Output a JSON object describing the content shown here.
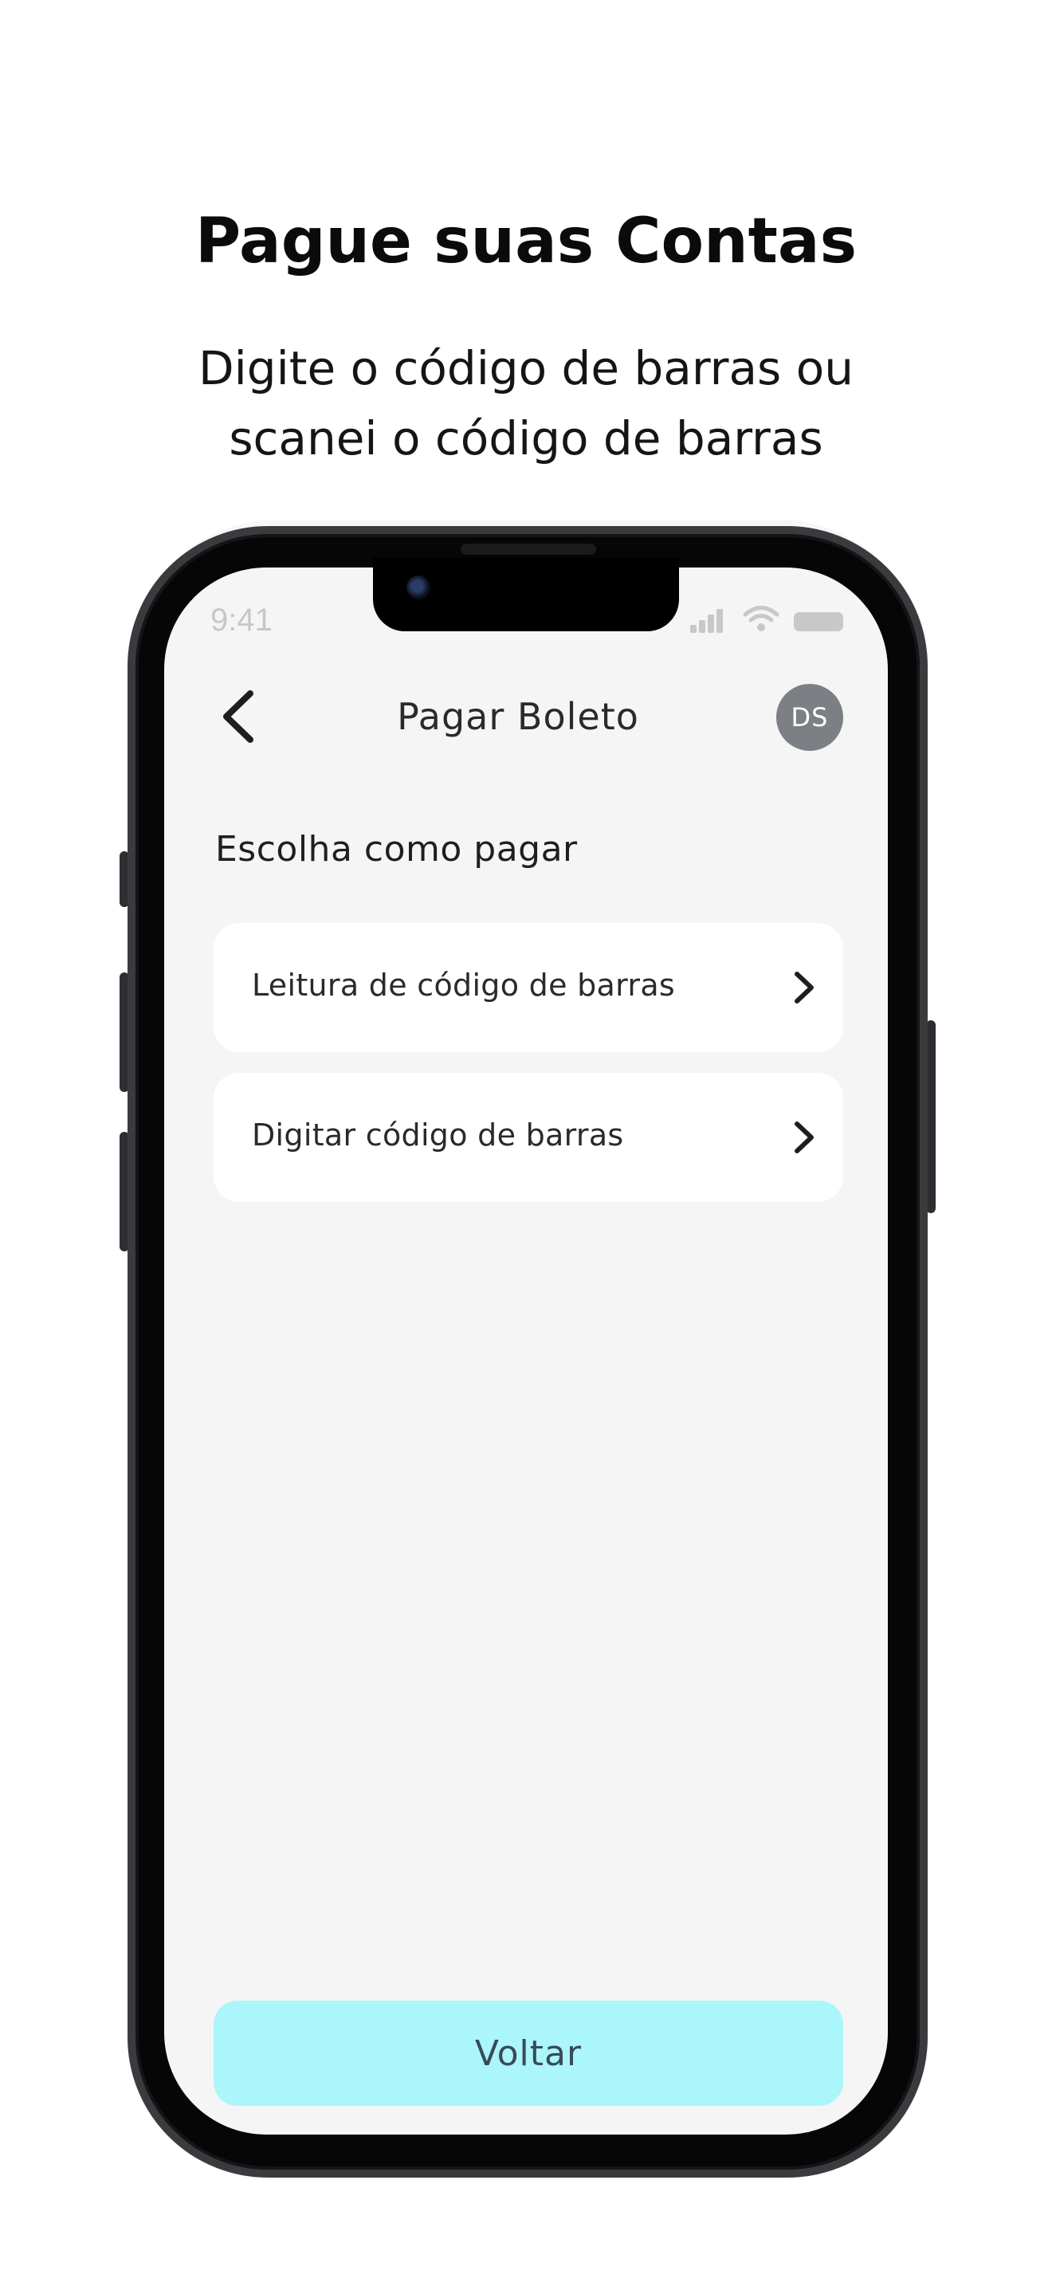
{
  "hero": {
    "title": "Pague suas Contas",
    "subtitle_line1": "Digite o código de barras ou",
    "subtitle_line2": "scanei o código de barras"
  },
  "status_bar": {
    "time": "9:41",
    "icons": [
      "signal-icon",
      "wifi-icon",
      "battery-icon"
    ]
  },
  "header": {
    "back_icon": "chevron-left-icon",
    "title": "Pagar Boleto",
    "avatar_initials": "DS"
  },
  "section": {
    "heading": "Escolha como pagar"
  },
  "options": [
    {
      "label": "Leitura de código de barras",
      "icon": "chevron-right-icon"
    },
    {
      "label": "Digitar código de barras",
      "icon": "chevron-right-icon"
    }
  ],
  "footer": {
    "back_label": "Voltar"
  },
  "colors": {
    "screen_background": "#f5f5f5",
    "card_background": "#ffffff",
    "avatar": "#7c7f84",
    "primary_button": "#aaf6fa",
    "phone_frame": "#060606"
  }
}
